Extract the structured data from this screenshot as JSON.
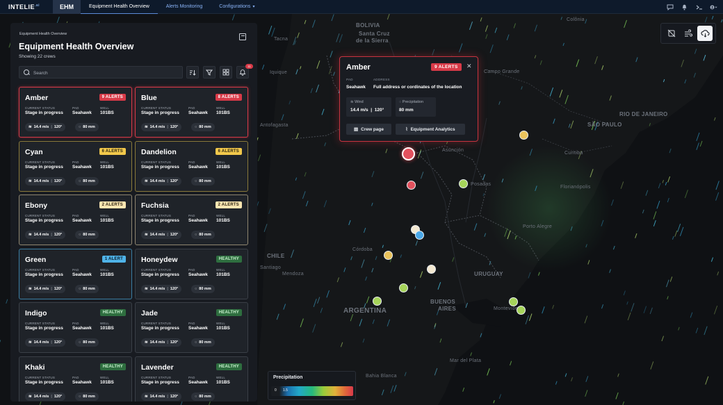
{
  "topbar": {
    "logo": "INTELIE",
    "product": "EHM",
    "tabs": [
      {
        "label": "Equipment Health Overview"
      },
      {
        "label": "Alerts Monitoring"
      },
      {
        "label": "Configurations"
      }
    ]
  },
  "panel": {
    "breadcrumb": "Equipment Health Overview",
    "title": "Equipment Health Overview",
    "subtitle": "Showing 22 crews",
    "search_placeholder": "Search",
    "notification_count": "11",
    "labels": {
      "status": "CURRENT STATUS",
      "pad": "PAD",
      "well": "WELL"
    },
    "crews": [
      {
        "name": "Amber",
        "badge": "9 ALERTS",
        "level": "critical",
        "status": "Stage in progress",
        "pad": "Seahawk",
        "well": "101BS",
        "wind": "14.4 m/s",
        "dir": "120°",
        "precip": "80 mm"
      },
      {
        "name": "Blue",
        "badge": "8 ALERTS",
        "level": "critical",
        "status": "Stage in progress",
        "pad": "Seahawk",
        "well": "101BS",
        "wind": "14.4 m/s",
        "dir": "120°",
        "precip": "80 mm"
      },
      {
        "name": "Cyan",
        "badge": "6 ALERTS",
        "level": "warning",
        "status": "Stage in progress",
        "pad": "Seahawk",
        "well": "101BS",
        "wind": "14.4 m/s",
        "dir": "120°",
        "precip": "80 mm"
      },
      {
        "name": "Dandelion",
        "badge": "6 ALERTS",
        "level": "warning",
        "status": "Stage in progress",
        "pad": "Seahawk",
        "well": "101BS",
        "wind": "14.4 m/s",
        "dir": "120°",
        "precip": "80 mm"
      },
      {
        "name": "Ebony",
        "badge": "2 ALERTS",
        "level": "minor",
        "status": "Stage in progress",
        "pad": "Seahawk",
        "well": "101BS",
        "wind": "14.4 m/s",
        "dir": "120°",
        "precip": "80 mm"
      },
      {
        "name": "Fuchsia",
        "badge": "2 ALERTS",
        "level": "minor",
        "status": "Stage in progress",
        "pad": "Seahawk",
        "well": "101BS",
        "wind": "14.4 m/s",
        "dir": "120°",
        "precip": "80 mm"
      },
      {
        "name": "Green",
        "badge": "1 ALERT",
        "level": "info",
        "status": "Stage in progress",
        "pad": "Seahawk",
        "well": "101BS",
        "wind": "14.4 m/s",
        "dir": "120°",
        "precip": "80 mm"
      },
      {
        "name": "Honeydew",
        "badge": "HEALTHY",
        "level": "healthy",
        "status": "Stage in progress",
        "pad": "Seahawk",
        "well": "101BS",
        "wind": "14.4 m/s",
        "dir": "120°",
        "precip": "80 mm"
      },
      {
        "name": "Indigo",
        "badge": "HEALTHY",
        "level": "healthy",
        "status": "Stage in progress",
        "pad": "Seahawk",
        "well": "101BS",
        "wind": "14.4 m/s",
        "dir": "120°",
        "precip": "80 mm"
      },
      {
        "name": "Jade",
        "badge": "HEALTHY",
        "level": "healthy",
        "status": "Stage in progress",
        "pad": "Seahawk",
        "well": "101BS",
        "wind": "14.4 m/s",
        "dir": "120°",
        "precip": "80 mm"
      },
      {
        "name": "Khaki",
        "badge": "HEALTHY",
        "level": "healthy",
        "status": "Stage in progress",
        "pad": "Seahawk",
        "well": "101BS",
        "wind": "14.4 m/s",
        "dir": "120°",
        "precip": "80 mm"
      },
      {
        "name": "Lavender",
        "badge": "HEALTHY",
        "level": "healthy",
        "status": "Stage in progress",
        "pad": "Seahawk",
        "well": "101BS",
        "wind": "14.4 m/s",
        "dir": "120°",
        "precip": "80 mm"
      }
    ]
  },
  "popup": {
    "title": "Amber",
    "badge": "9 ALERTS",
    "pad_label": "PAD",
    "pad": "Seahawk",
    "address_label": "ADDRESS",
    "address": "Full address or cordinates of the location",
    "wind_label": "Wind",
    "wind": "14.4 m/s",
    "wind_dir": "120°",
    "precip_label": "Precipitation",
    "precip": "80 mm",
    "crew_page": "Crew page",
    "analytics": "Equipment Analytics"
  },
  "legend": {
    "title": "Precipitation",
    "ticks": [
      "0",
      "1.5",
      "",
      "",
      "",
      "",
      "",
      ""
    ]
  },
  "map_labels": [
    {
      "text": "BOLIVIA"
    },
    {
      "text": "Santa Cruz"
    },
    {
      "text": "de la Sierra"
    },
    {
      "text": "Tacna"
    },
    {
      "text": "Iquique"
    },
    {
      "text": "Colônia"
    },
    {
      "text": "Campo Grande"
    },
    {
      "text": "RIO DE JANEIRO"
    },
    {
      "text": "SÃO PAULO"
    },
    {
      "text": "Curitiba"
    },
    {
      "text": "Florianópolis"
    },
    {
      "text": "Asunción"
    },
    {
      "text": "Posadas"
    },
    {
      "text": "Porto Alegre"
    },
    {
      "text": "Córdoba"
    },
    {
      "text": "CHILE"
    },
    {
      "text": "Mendoza"
    },
    {
      "text": "URUGUAY"
    },
    {
      "text": "BUENOS"
    },
    {
      "text": "AIRES"
    },
    {
      "text": "ARGENTINA"
    },
    {
      "text": "Mar del Plata"
    },
    {
      "text": "Bahia Blanca"
    },
    {
      "text": "Montevideo"
    },
    {
      "text": "Antofagasta"
    },
    {
      "text": "Santiago"
    }
  ],
  "colors": {
    "critical": "#d83a48",
    "warning": "#f2c84b",
    "minor": "#fbe6b2",
    "info": "#4fb3e8",
    "healthy": "#2e6e3f",
    "marker_red": "#e2525e",
    "marker_yellow": "#e9c25b",
    "marker_green": "#a6d45a",
    "marker_cream": "#f2e8d0",
    "marker_blue": "#4aa8e8"
  }
}
